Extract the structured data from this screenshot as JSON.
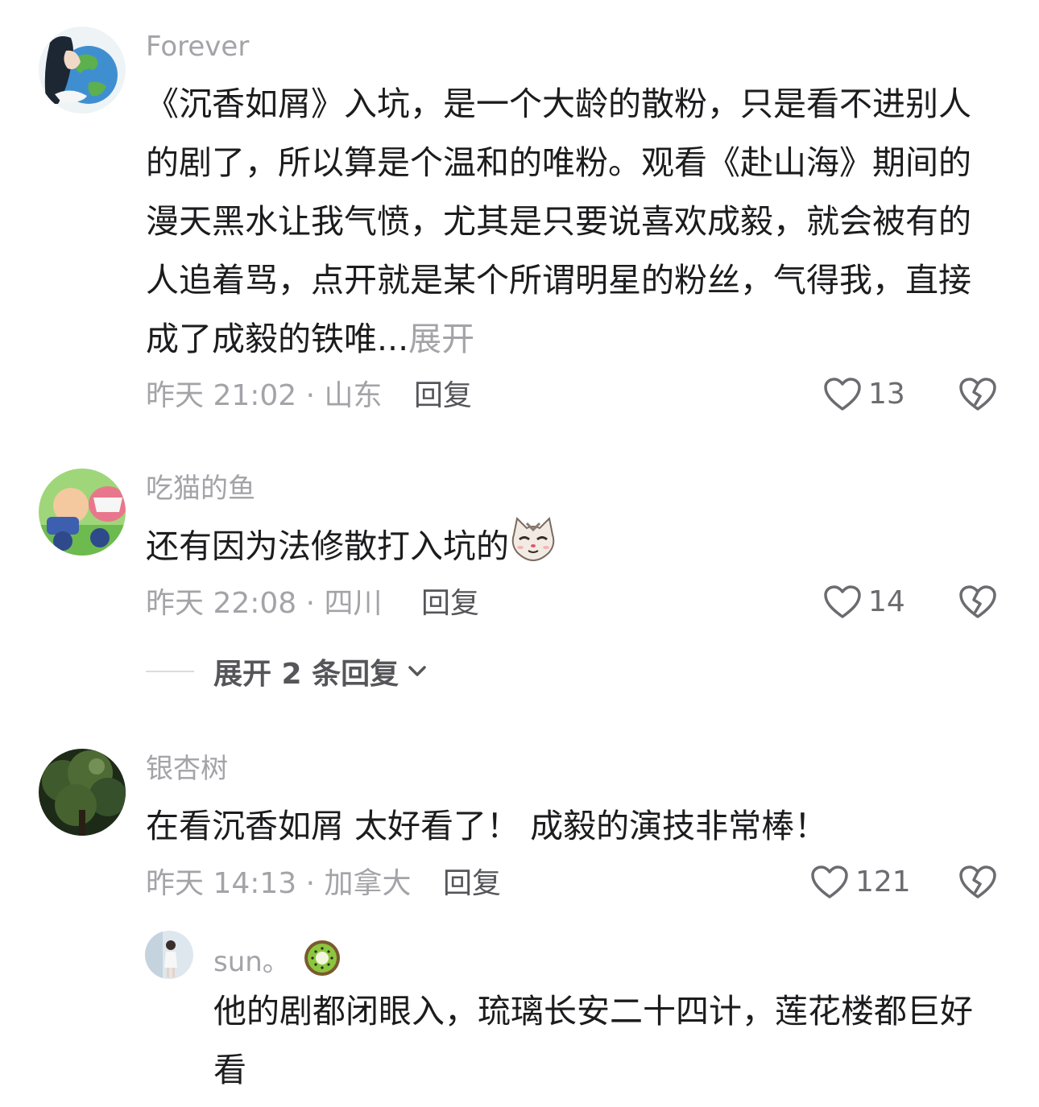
{
  "comments": [
    {
      "username": "Forever",
      "content": "《沉香如屑》入坑，是一个大龄的散粉，只是看不进别人的剧了，所以算是个温和的唯粉。观看《赴山海》期间的漫天黑水让我气愤，尤其是只要说喜欢成毅，就会被有的人追着骂，点开就是某个所谓明星的粉丝，气得我，直接成了成毅的铁唯...",
      "expand_label": "展开",
      "time_location": "昨天 21:02 · 山东",
      "reply_label": "回复",
      "likes": "13"
    },
    {
      "username": "吃猫的鱼",
      "content": "还有因为法修散打入坑的",
      "emoji": "cat-face-emoji",
      "time_location": "昨天 22:08 · 四川",
      "reply_label": "回复",
      "likes": "14",
      "expand_replies_label": "展开 2 条回复"
    },
    {
      "username": "银杏树",
      "content": "在看沉香如屑 太好看了！ 成毅的演技非常棒！",
      "time_location": "昨天 14:13 · 加拿大",
      "reply_label": "回复",
      "likes": "121",
      "reply": {
        "username": "sun。",
        "badge": "kiwi-emoji",
        "content": "他的剧都闭眼入，琉璃长安二十四计，莲花楼都巨好看"
      }
    }
  ]
}
